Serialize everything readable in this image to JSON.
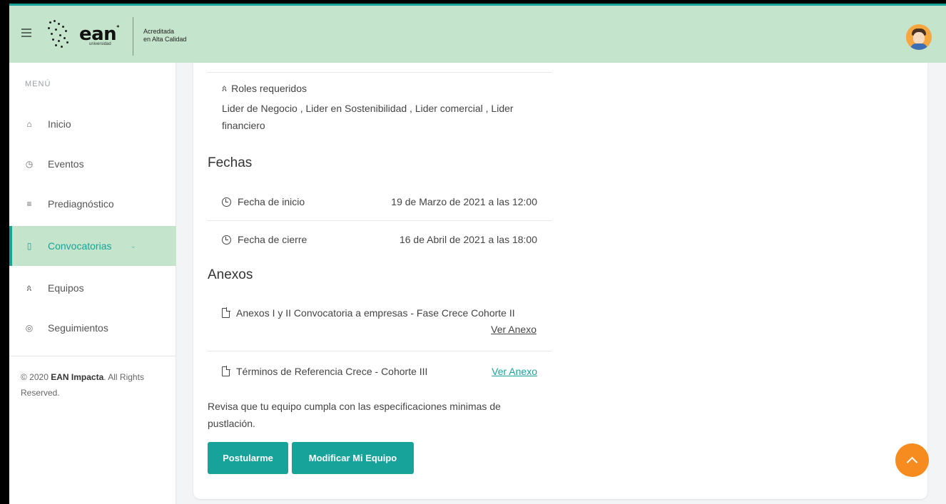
{
  "header": {
    "logo_word": "ean",
    "logo_sub": "universidad",
    "accreditation_line1": "Acreditada",
    "accreditation_line2": "en Alta Calidad",
    "brand_color": "#18a39a",
    "header_bg": "#c5e4cc"
  },
  "sidebar": {
    "menu_title": "MENÚ",
    "items": [
      {
        "label": "Inicio",
        "icon": "home-icon"
      },
      {
        "label": "Eventos",
        "icon": "clock-icon"
      },
      {
        "label": "Prediagnóstico",
        "icon": "list-icon"
      },
      {
        "label": "Convocatorias",
        "icon": "document-icon",
        "active": true
      },
      {
        "label": "Equipos",
        "icon": "team-icon"
      },
      {
        "label": "Seguimientos",
        "icon": "target-icon"
      }
    ],
    "copyright_prefix": "© 2020 ",
    "copyright_brand": "EAN Impacta",
    "copyright_suffix": ". All Rights Reserved."
  },
  "main": {
    "roles_label": "Roles requeridos",
    "roles_text": "Lider de Negocio , Lider en Sostenibilidad , Lider comercial , Lider financiero",
    "dates_heading": "Fechas",
    "dates": [
      {
        "label": "Fecha de inicio",
        "value": "19 de Marzo de 2021 a las 12:00"
      },
      {
        "label": "Fecha de cierre",
        "value": "16 de Abril de 2021 a las 18:00"
      }
    ],
    "annexes_heading": "Anexos",
    "annexes": [
      {
        "title": "Anexos I y II Convocatoria a empresas - Fase Crece Cohorte II",
        "link": "Ver Anexo"
      },
      {
        "title": "Términos de Referencia Crece - Cohorte III",
        "link": "Ver Anexo"
      }
    ],
    "notice": "Revisa que tu equipo cumpla con las especificaciones minimas de pustlación.",
    "apply_button": "Postularme",
    "modify_button": "Modificar Mi Equipo"
  },
  "accent_orange": "#f68b1f"
}
